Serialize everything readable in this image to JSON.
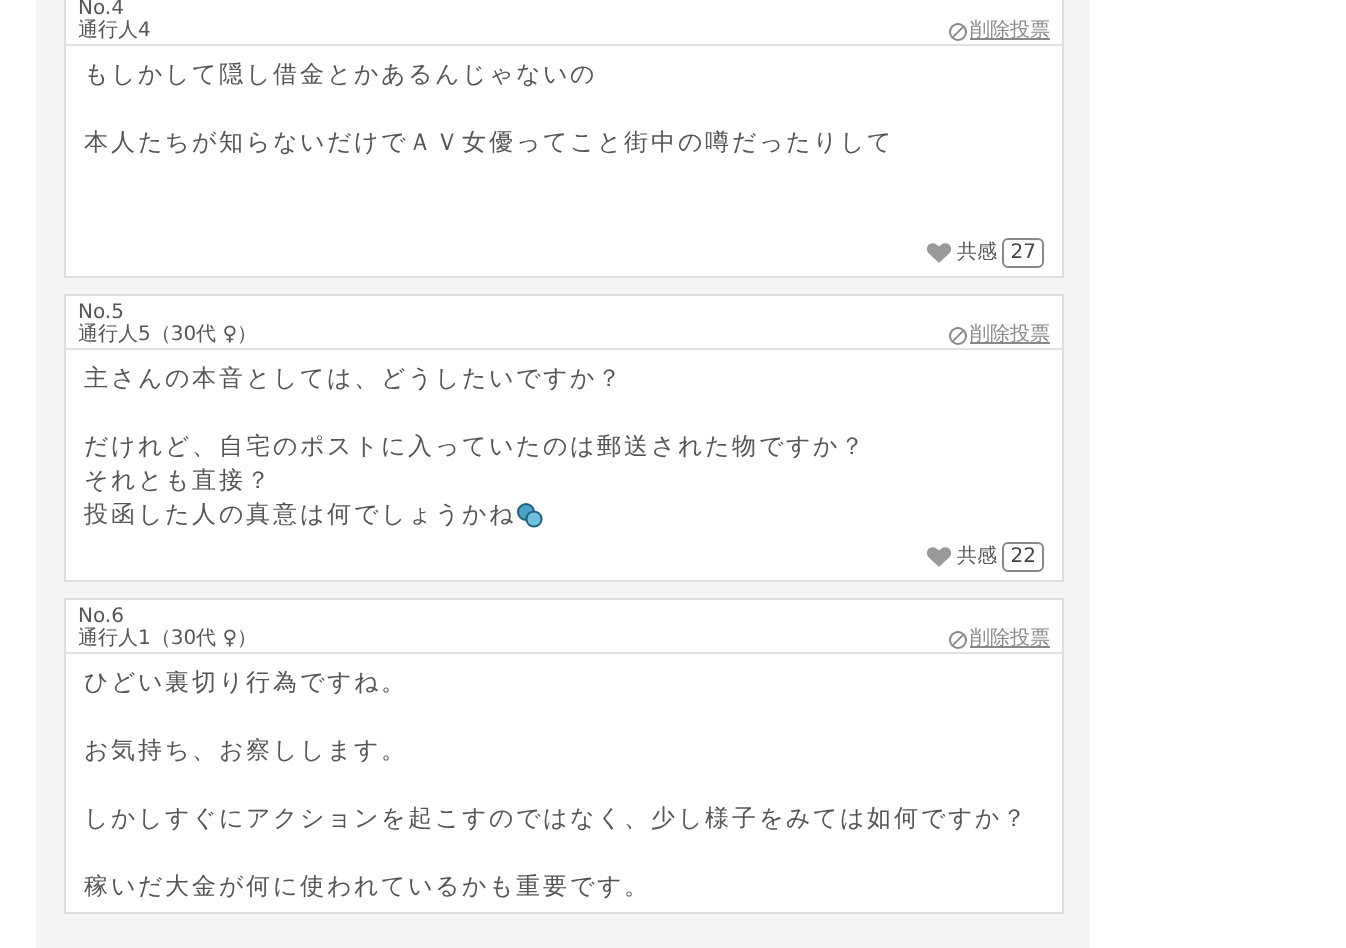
{
  "posts": [
    {
      "number": "No.4",
      "author": "通行人4",
      "report_link": "削除投票",
      "paragraphs": [
        [
          "もしかして隠し借金とかあるんじゃないの"
        ],
        [
          "本人たちが知らないだけでＡＶ女優ってこと街中の噂だったりして"
        ]
      ],
      "has_emoji": false,
      "empathy_label": "共感",
      "empathy_count": "27"
    },
    {
      "number": "No.5",
      "author": "通行人5（30代 ♀）",
      "report_link": "削除投票",
      "paragraphs": [
        [
          "主さんの本音としては、どうしたいですか？"
        ],
        [
          "だけれど、自宅のポストに入っていたのは郵送された物ですか？",
          "それとも直接？",
          "投函した人の真意は何でしょうかね"
        ]
      ],
      "has_emoji": true,
      "empathy_label": "共感",
      "empathy_count": "22"
    },
    {
      "number": "No.6",
      "author": "通行人1（30代 ♀）",
      "report_link": "削除投票",
      "paragraphs": [
        [
          "ひどい裏切り行為ですね。"
        ],
        [
          "お気持ち、お察しします。"
        ],
        [
          "しかしすぐにアクションを起こすのではなく、少し様子をみては如何ですか？"
        ],
        [
          "稼いだ大金が何に使われているかも重要です。"
        ]
      ],
      "has_emoji": false
    }
  ]
}
